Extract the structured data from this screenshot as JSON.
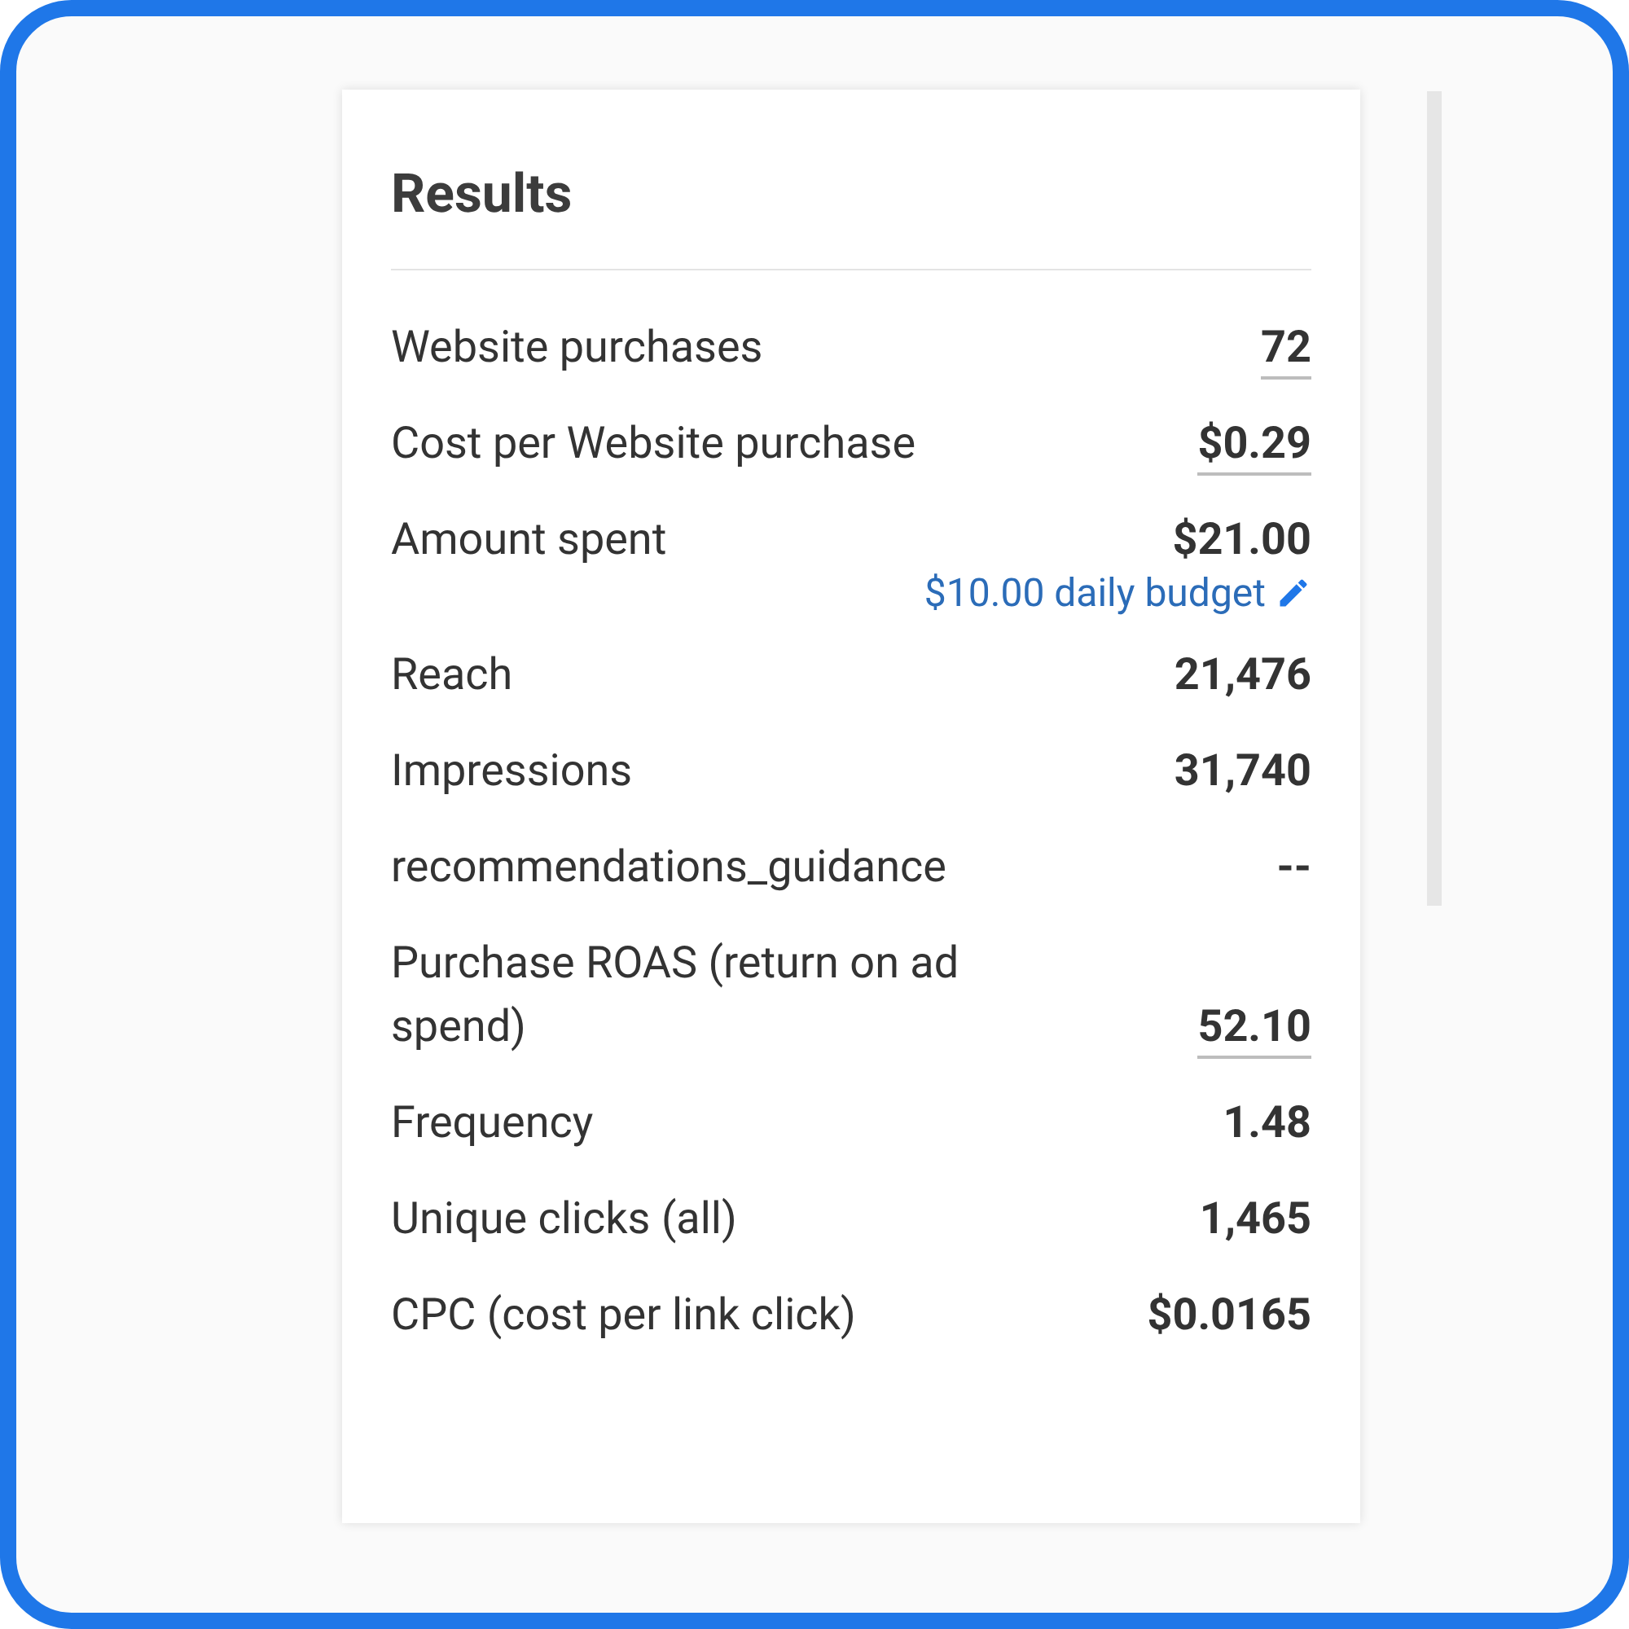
{
  "title": "Results",
  "rows": [
    {
      "label": "Website purchases",
      "value": "72",
      "underlined": true
    },
    {
      "label": "Cost per Website purchase",
      "value": "$0.29",
      "underlined": true
    },
    {
      "label": "Amount spent",
      "value": "$21.00",
      "underlined": false,
      "link": "$10.00 daily budget"
    },
    {
      "label": "Reach",
      "value": "21,476",
      "underlined": false
    },
    {
      "label": "Impressions",
      "value": "31,740",
      "underlined": false
    },
    {
      "label": "recommendations_guidance",
      "value": "--",
      "underlined": false
    },
    {
      "label": "Purchase ROAS (return on ad spend)",
      "value": "52.10",
      "underlined": true
    },
    {
      "label": "Frequency",
      "value": "1.48",
      "underlined": false
    },
    {
      "label": "Unique clicks (all)",
      "value": "1,465",
      "underlined": false
    },
    {
      "label": "CPC (cost per link click)",
      "value": "$0.0165",
      "underlined": false
    }
  ]
}
